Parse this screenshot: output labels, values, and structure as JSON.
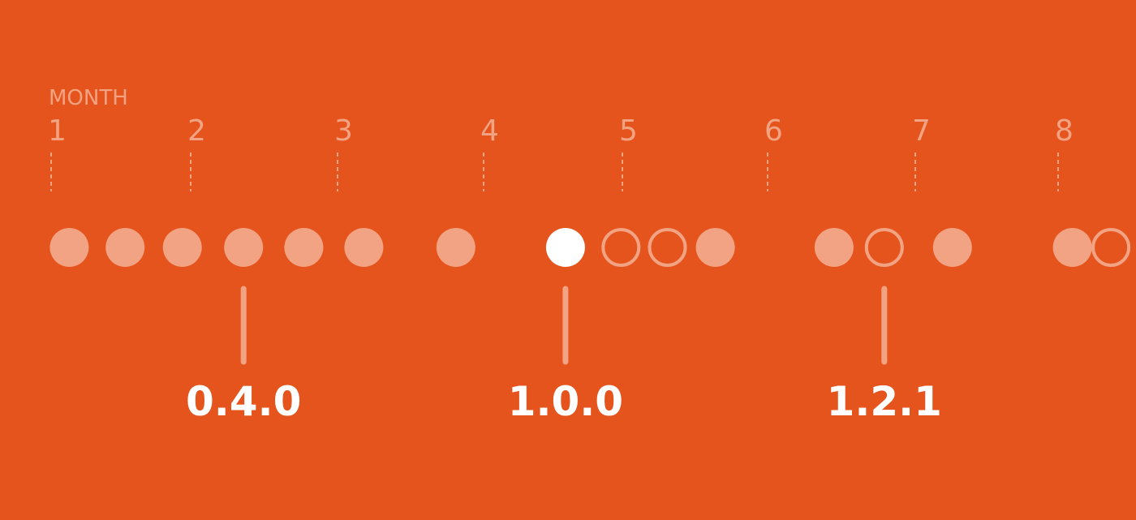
{
  "colors": {
    "background": "#E5541C",
    "faded": "#F2A383",
    "highlight": "#FFFFFF"
  },
  "timeline": {
    "axis_label": "MONTH",
    "months": [
      "1",
      "2",
      "3",
      "4",
      "5",
      "6",
      "7",
      "8"
    ],
    "releases": [
      {
        "month": 1.13,
        "style": "filled"
      },
      {
        "month": 1.53,
        "style": "filled"
      },
      {
        "month": 1.94,
        "style": "filled"
      },
      {
        "month": 2.36,
        "style": "filled"
      },
      {
        "month": 2.77,
        "style": "filled"
      },
      {
        "month": 3.18,
        "style": "filled"
      },
      {
        "month": 3.81,
        "style": "filled"
      },
      {
        "month": 4.59,
        "style": "highlight"
      },
      {
        "month": 4.99,
        "style": "outline"
      },
      {
        "month": 5.31,
        "style": "outline"
      },
      {
        "month": 5.64,
        "style": "filled"
      },
      {
        "month": 6.45,
        "style": "filled"
      },
      {
        "month": 6.79,
        "style": "outline"
      },
      {
        "month": 7.26,
        "style": "filled"
      },
      {
        "month": 8.1,
        "style": "filled"
      },
      {
        "month": 8.37,
        "style": "outline"
      }
    ],
    "callouts": [
      {
        "month": 2.36,
        "label": "0.4.0",
        "style": "faded"
      },
      {
        "month": 4.59,
        "label": "1.0.0",
        "style": "faded"
      },
      {
        "month": 6.79,
        "label": "1.2.1",
        "style": "faded"
      }
    ]
  }
}
